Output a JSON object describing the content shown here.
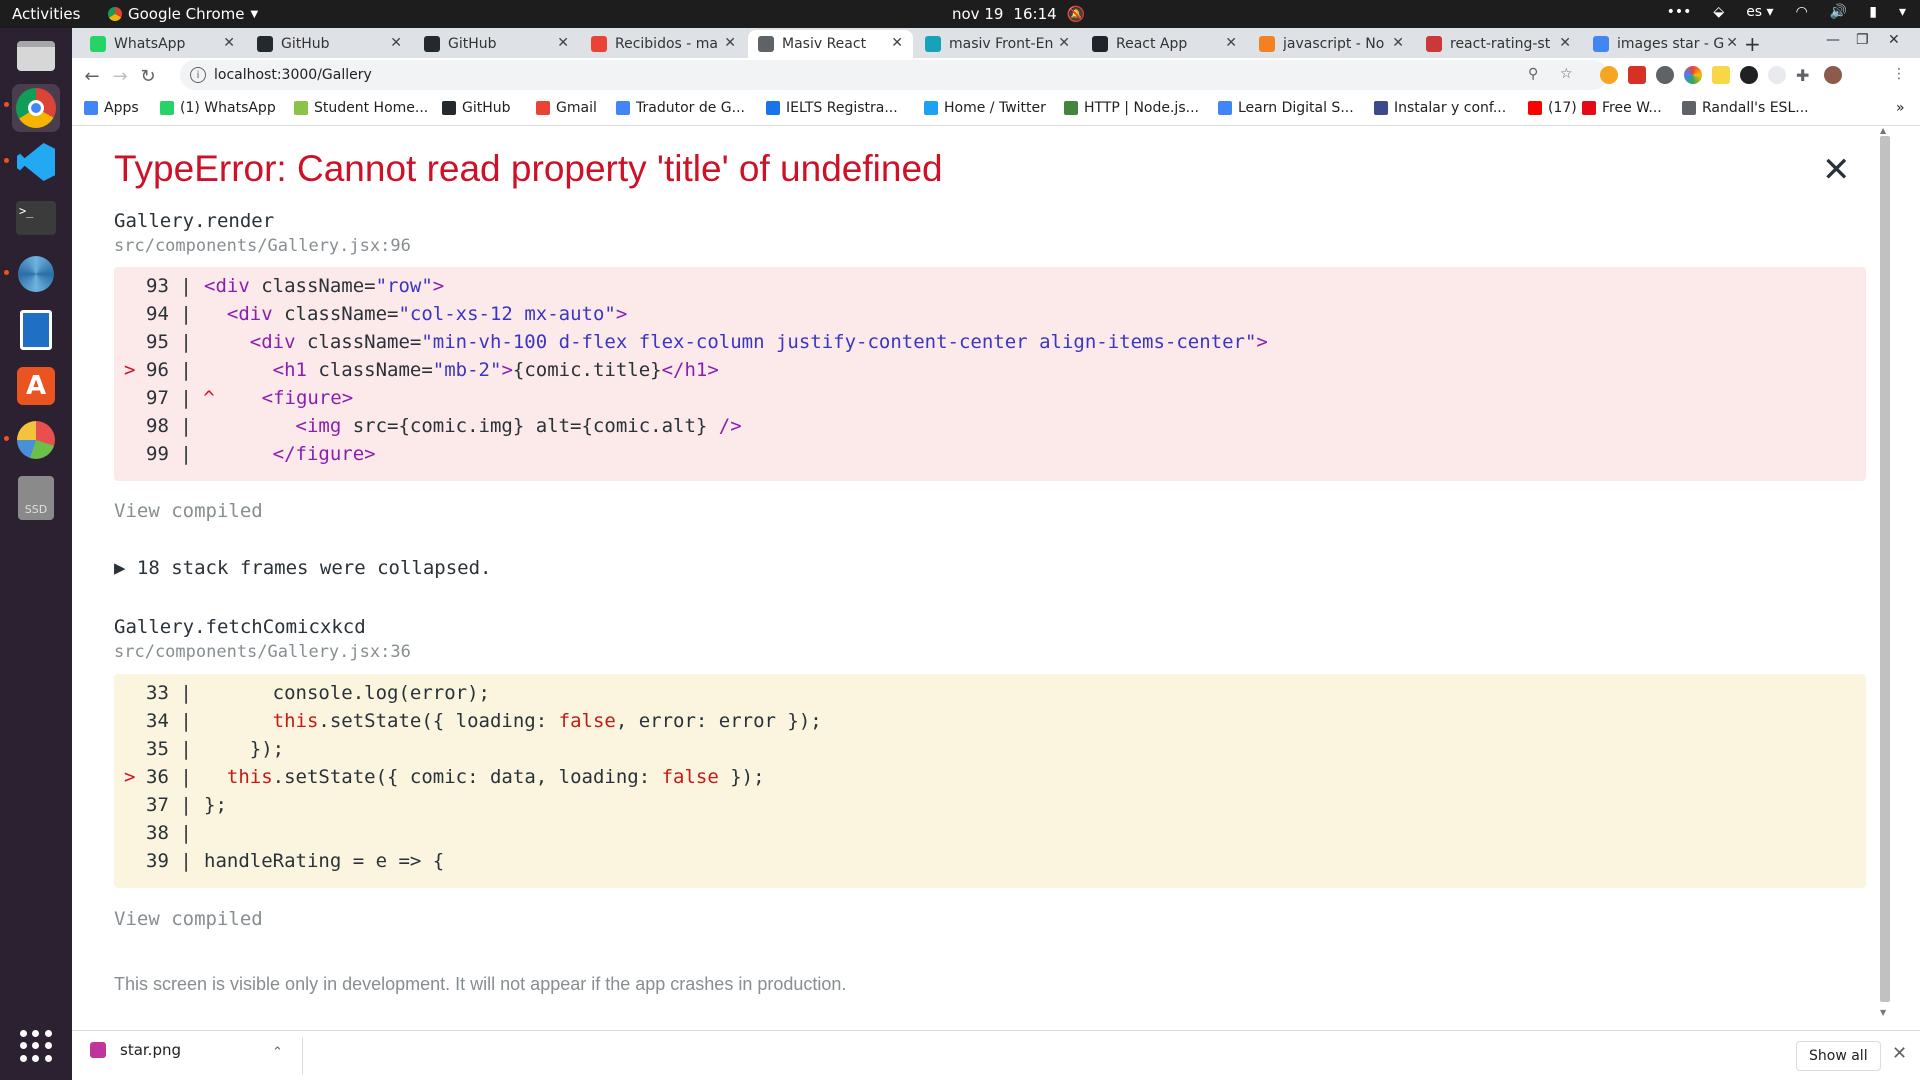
{
  "topbar": {
    "activities": "Activities",
    "app_name": "Google Chrome",
    "clock_date": "nov 19",
    "clock_time": "16:14",
    "language": "es"
  },
  "tabs": [
    {
      "label": "WhatsApp",
      "icon": "whatsapp-icon",
      "color": "#25d366"
    },
    {
      "label": "GitHub",
      "icon": "github-icon",
      "color": "#24292e"
    },
    {
      "label": "GitHub",
      "icon": "github-icon",
      "color": "#24292e"
    },
    {
      "label": "Recibidos - ma",
      "icon": "gmail-icon",
      "color": "#ea4335"
    },
    {
      "label": "Masiv React",
      "icon": "globe-icon",
      "color": "#5f6368",
      "active": true
    },
    {
      "label": "masiv Front-En",
      "icon": "react-icon",
      "color": "#16a2b8"
    },
    {
      "label": "React App",
      "icon": "react-icon",
      "color": "#20232a"
    },
    {
      "label": "javascript - No",
      "icon": "stackoverflow-icon",
      "color": "#f48024"
    },
    {
      "label": "react-rating-st",
      "icon": "npm-icon",
      "color": "#cb3837"
    },
    {
      "label": "images star - G",
      "icon": "google-icon",
      "color": "#4285f4"
    }
  ],
  "toolbar": {
    "url": "localhost:3000/Gallery"
  },
  "bookmarks": [
    {
      "label": "Apps",
      "icon": "apps-icon",
      "color": "#4285f4"
    },
    {
      "label": "(1) WhatsApp",
      "icon": "whatsapp-icon",
      "color": "#25d366"
    },
    {
      "label": "Student Home...",
      "icon": "diamond-icon",
      "color": "#8bc34a"
    },
    {
      "label": "GitHub",
      "icon": "github-icon",
      "color": "#24292e"
    },
    {
      "label": "Gmail",
      "icon": "gmail-icon",
      "color": "#ea4335"
    },
    {
      "label": "Tradutor de G...",
      "icon": "translate-icon",
      "color": "#4285f4"
    },
    {
      "label": "IELTS Registra...",
      "icon": "ielts-icon",
      "color": "#1a73e8"
    },
    {
      "label": "Home / Twitter",
      "icon": "twitter-icon",
      "color": "#1da1f2"
    },
    {
      "label": "HTTP | Node.js...",
      "icon": "nodejs-icon",
      "color": "#43853d"
    },
    {
      "label": "Learn Digital S...",
      "icon": "google-icon",
      "color": "#4285f4"
    },
    {
      "label": "Instalar y conf...",
      "icon": "link-icon",
      "color": "#3c4a8c"
    },
    {
      "label": "(17)",
      "icon": "youtube-icon",
      "color": "#ff0000"
    },
    {
      "label": "Free W...",
      "icon": "circle-icon",
      "color": "#e50914"
    },
    {
      "label": "Randall's ESL...",
      "icon": "headphones-icon",
      "color": "#5f6368"
    }
  ],
  "error": {
    "title": "TypeError: Cannot read property 'title' of undefined",
    "frame1_name": "Gallery.render",
    "frame1_file": "src/components/Gallery.jsx:96",
    "frame1_lines": [
      {
        "num": "93",
        "marker": "",
        "caret": false,
        "segments": [
          [
            "tag",
            "<div "
          ],
          [
            "",
            "className="
          ],
          [
            "str",
            "\"row\""
          ],
          [
            "tag",
            ">"
          ]
        ]
      },
      {
        "num": "94",
        "marker": "",
        "caret": false,
        "segments": [
          [
            "",
            "  "
          ],
          [
            "tag",
            "<div "
          ],
          [
            "",
            "className="
          ],
          [
            "str",
            "\"col-xs-12 mx-auto\""
          ],
          [
            "tag",
            ">"
          ]
        ]
      },
      {
        "num": "95",
        "marker": "",
        "caret": false,
        "segments": [
          [
            "",
            "    "
          ],
          [
            "tag",
            "<div "
          ],
          [
            "",
            "className="
          ],
          [
            "str",
            "\"min-vh-100 d-flex flex-column justify-content-center align-items-center\""
          ],
          [
            "tag",
            ">"
          ]
        ]
      },
      {
        "num": "96",
        "marker": ">",
        "caret": false,
        "segments": [
          [
            "",
            "      "
          ],
          [
            "tag",
            "<h1 "
          ],
          [
            "",
            "className="
          ],
          [
            "str",
            "\"mb-2\""
          ],
          [
            "tag",
            ">"
          ],
          [
            "",
            "{comic.title}"
          ],
          [
            "tag",
            "</h1>"
          ]
        ]
      },
      {
        "num": "97",
        "marker": "",
        "caret": true,
        "segments": [
          [
            "",
            "      "
          ],
          [
            "tag",
            "<figure>"
          ]
        ]
      },
      {
        "num": "98",
        "marker": "",
        "caret": false,
        "segments": [
          [
            "",
            "        "
          ],
          [
            "tag",
            "<img "
          ],
          [
            "",
            "src={comic.img} alt={comic.alt} "
          ],
          [
            "tag",
            "/>"
          ]
        ]
      },
      {
        "num": "99",
        "marker": "",
        "caret": false,
        "segments": [
          [
            "",
            "      "
          ],
          [
            "tag",
            "</figure>"
          ]
        ]
      }
    ],
    "view_compiled": "View compiled",
    "collapsed": "▶ 18 stack frames were collapsed.",
    "frame2_name": "Gallery.fetchComicxkcd",
    "frame2_file": "src/components/Gallery.jsx:36",
    "frame2_lines": [
      {
        "num": "33",
        "marker": "",
        "caret": false,
        "segments": [
          [
            "",
            "      console.log(error);"
          ]
        ]
      },
      {
        "num": "34",
        "marker": "",
        "caret": false,
        "segments": [
          [
            "",
            "      "
          ],
          [
            "kw",
            "this"
          ],
          [
            "",
            ".setState({ loading: "
          ],
          [
            "kw",
            "false"
          ],
          [
            "",
            ", error: error });"
          ]
        ]
      },
      {
        "num": "35",
        "marker": "",
        "caret": false,
        "segments": [
          [
            "",
            "    });"
          ]
        ]
      },
      {
        "num": "36",
        "marker": ">",
        "caret": false,
        "segments": [
          [
            "",
            "  "
          ],
          [
            "kw",
            "this"
          ],
          [
            "",
            ".setState({ comic: data, loading: "
          ],
          [
            "kw",
            "false"
          ],
          [
            "",
            " });"
          ]
        ]
      },
      {
        "num": "37",
        "marker": "",
        "caret": false,
        "segments": [
          [
            "",
            "};"
          ]
        ]
      },
      {
        "num": "38",
        "marker": "",
        "caret": false,
        "segments": [
          [
            "",
            ""
          ]
        ]
      },
      {
        "num": "39",
        "marker": "",
        "caret": false,
        "segments": [
          [
            "",
            "handleRating = e => {"
          ]
        ]
      }
    ],
    "footer_note": "This screen is visible only in development. It will not appear if the app crashes in production."
  },
  "download_bar": {
    "file_name": "star.png",
    "show_all": "Show all"
  }
}
